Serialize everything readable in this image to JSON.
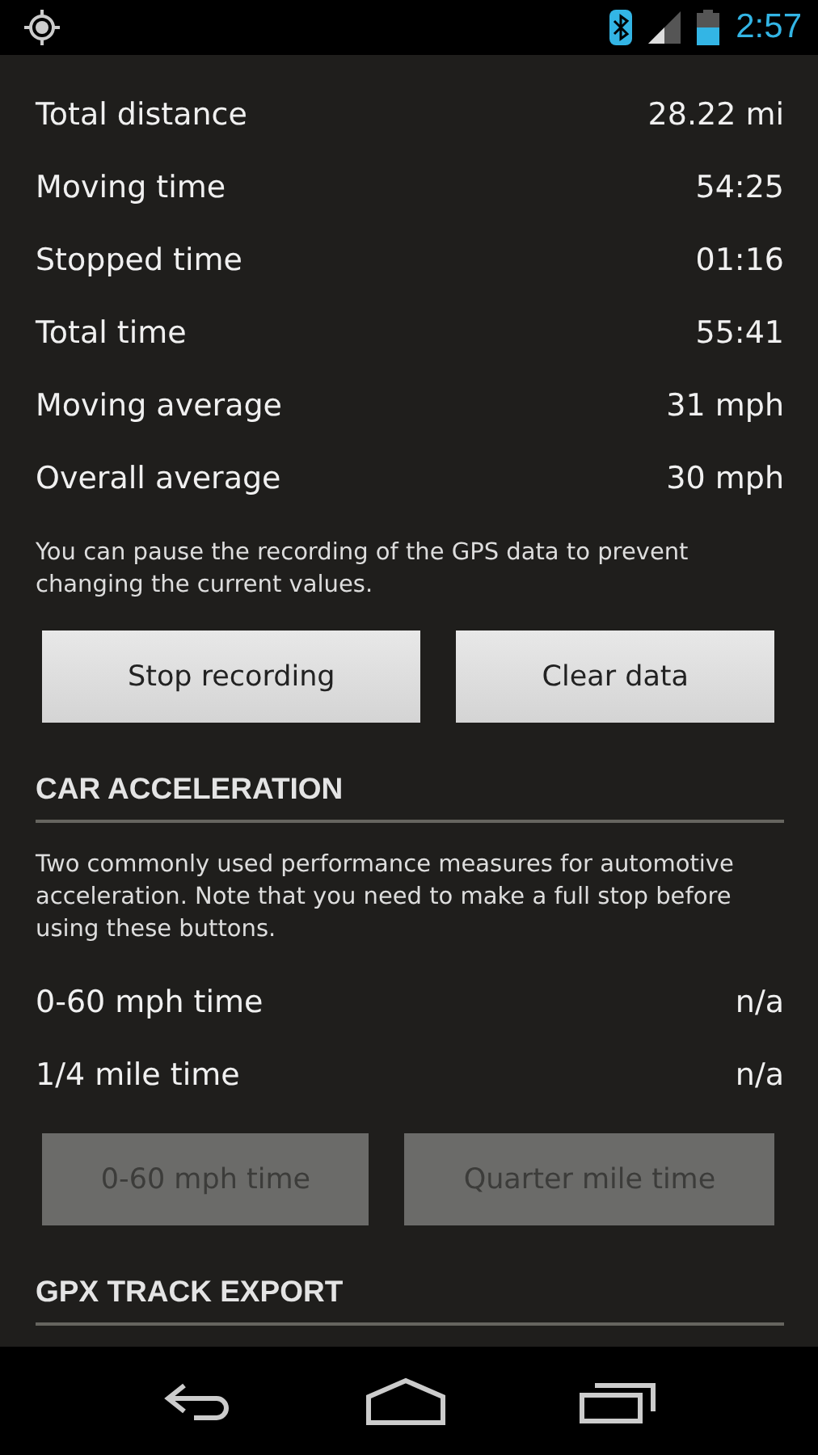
{
  "status_bar": {
    "time": "2:57"
  },
  "stats": [
    {
      "label": "Total distance",
      "value": "28.22 mi"
    },
    {
      "label": "Moving time",
      "value": "54:25"
    },
    {
      "label": "Stopped time",
      "value": "01:16"
    },
    {
      "label": "Total time",
      "value": "55:41"
    },
    {
      "label": "Moving average",
      "value": "31 mph"
    },
    {
      "label": "Overall average",
      "value": "30 mph"
    }
  ],
  "pause_note": "You can pause the recording of the GPS data to prevent changing the current values.",
  "record_buttons": [
    {
      "label": "Stop recording",
      "disabled": false
    },
    {
      "label": "Clear data",
      "disabled": false
    }
  ],
  "sections": [
    {
      "title": "CAR ACCELERATION",
      "description": "Two commonly used performance measures for automotive acceleration. Note that you need to make a full stop before using these buttons.",
      "stats": [
        {
          "label": "0-60 mph time",
          "value": "n/a"
        },
        {
          "label": "1/4 mile time",
          "value": "n/a"
        }
      ],
      "buttons": [
        {
          "label": "0-60 mph time",
          "disabled": true
        },
        {
          "label": "Quarter mile time",
          "disabled": true
        }
      ]
    },
    {
      "title": "GPX TRACK EXPORT"
    }
  ]
}
